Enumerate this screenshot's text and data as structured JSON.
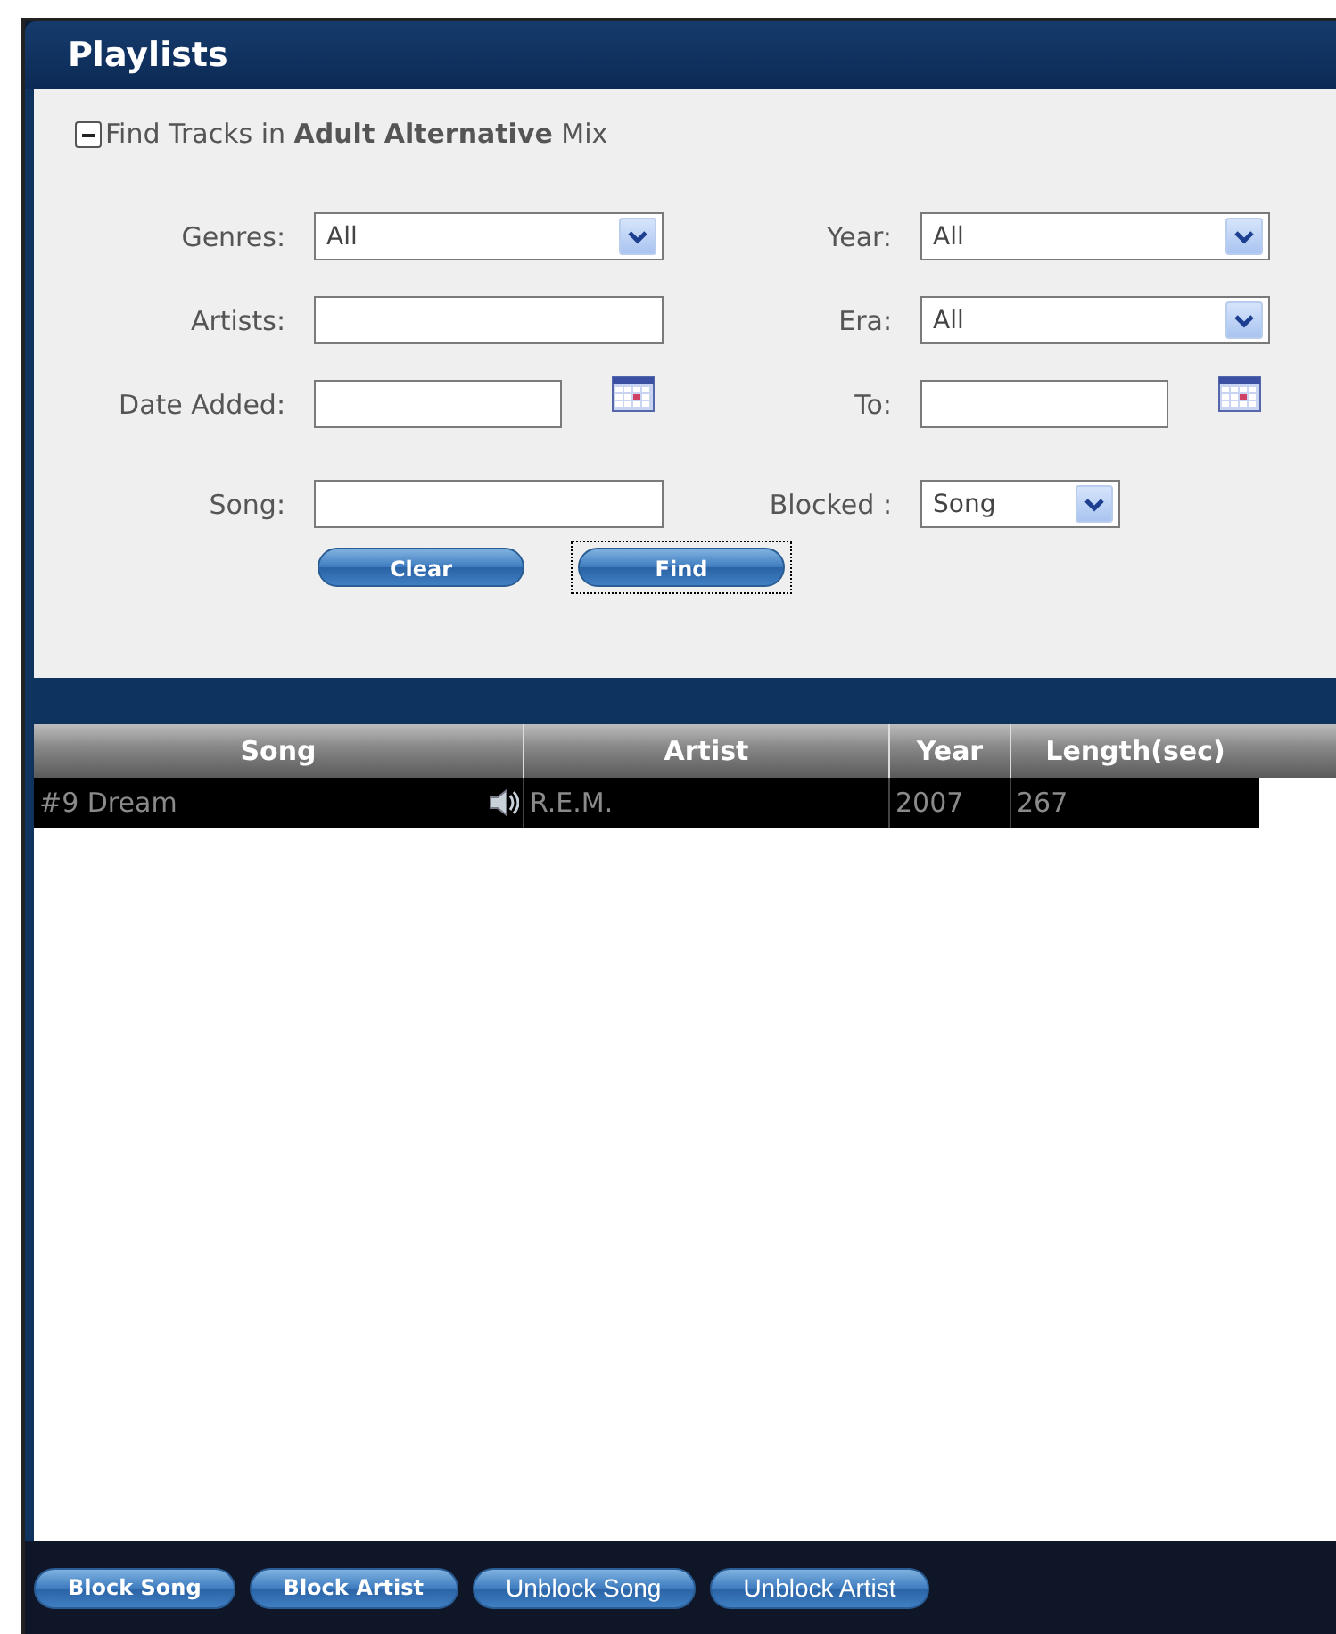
{
  "window": {
    "title": "Playlists"
  },
  "search_panel": {
    "expanded": true,
    "heading": "Find Tracks in **Adult Alternative** Mix",
    "fields": [
      {
        "label": "Genres:",
        "kind": "select",
        "value": "All"
      },
      {
        "label": "Year:",
        "kind": "select",
        "value": "All"
      },
      {
        "label": "Artists:",
        "kind": "text"
      },
      {
        "label": "Era:",
        "kind": "select",
        "value": "All"
      },
      {
        "label": "Date Added:",
        "kind": "date"
      },
      {
        "label": "To:",
        "kind": "date"
      },
      {
        "label": "Song:",
        "kind": "text"
      },
      {
        "label": "Blocked :",
        "kind": "small-select",
        "value": "Song"
      }
    ],
    "buttons": [
      {
        "label": "Clear",
        "focused": false
      },
      {
        "label": "Find",
        "focused": true
      }
    ]
  },
  "table": {
    "columns": [
      "Song",
      "Artist",
      "Year",
      "Length(sec)"
    ],
    "rows": [
      {
        "selected": true,
        "playing": true,
        "cells": [
          "#9 Dream",
          "R.E.M.",
          "2007",
          "267"
        ]
      }
    ]
  },
  "actions": [
    "Block Song",
    "Block Artist",
    "Unblock Song",
    "Unblock Artist"
  ]
}
